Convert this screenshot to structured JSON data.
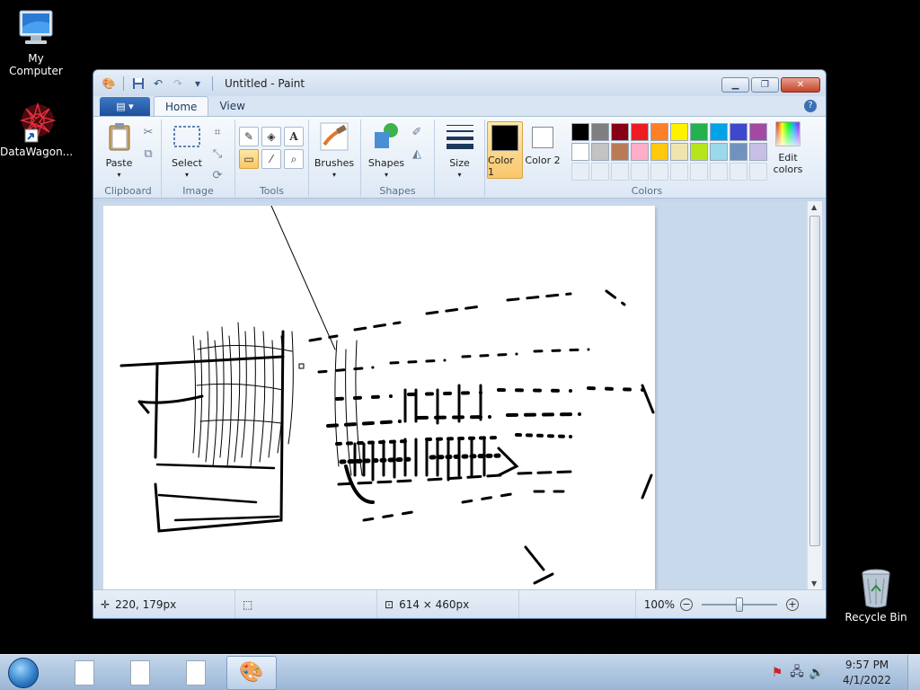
{
  "desktop": {
    "icons": [
      {
        "label": "My Computer"
      },
      {
        "label": "DataWagon..."
      },
      {
        "label": "Recycle Bin"
      }
    ]
  },
  "window": {
    "title": "Untitled - Paint",
    "tabs": {
      "file": "▤ ▾",
      "home": "Home",
      "view": "View"
    },
    "help": "?",
    "groups": {
      "clipboard": {
        "label": "Clipboard",
        "paste": "Paste"
      },
      "image": {
        "label": "Image",
        "select": "Select"
      },
      "tools": {
        "label": "Tools"
      },
      "brushes": {
        "label": "Brushes"
      },
      "shapes": {
        "label": "Shapes",
        "shapes_btn": "Shapes"
      },
      "size": {
        "label": "Size"
      },
      "colors": {
        "label": "Colors",
        "color1": "Color 1",
        "color2": "Color 2",
        "edit_colors": "Edit colors",
        "color1_value": "#000000",
        "color2_value": "#ffffff",
        "palette_row1": [
          "#000000",
          "#7f7f7f",
          "#880015",
          "#ed1c24",
          "#ff7f27",
          "#fff200",
          "#22b14c",
          "#00a2e8",
          "#3f48cc",
          "#a349a4"
        ],
        "palette_row2": [
          "#ffffff",
          "#c3c3c3",
          "#b97a57",
          "#ffaec9",
          "#ffc90e",
          "#efe4b0",
          "#b5e61d",
          "#99d9ea",
          "#7092be",
          "#c8bfe7"
        ]
      }
    },
    "status": {
      "cursor_pos": "220, 179px",
      "canvas_size": "614 × 460px",
      "zoom": "100%"
    }
  },
  "taskbar": {
    "time": "9:57 PM",
    "date": "4/1/2022"
  }
}
